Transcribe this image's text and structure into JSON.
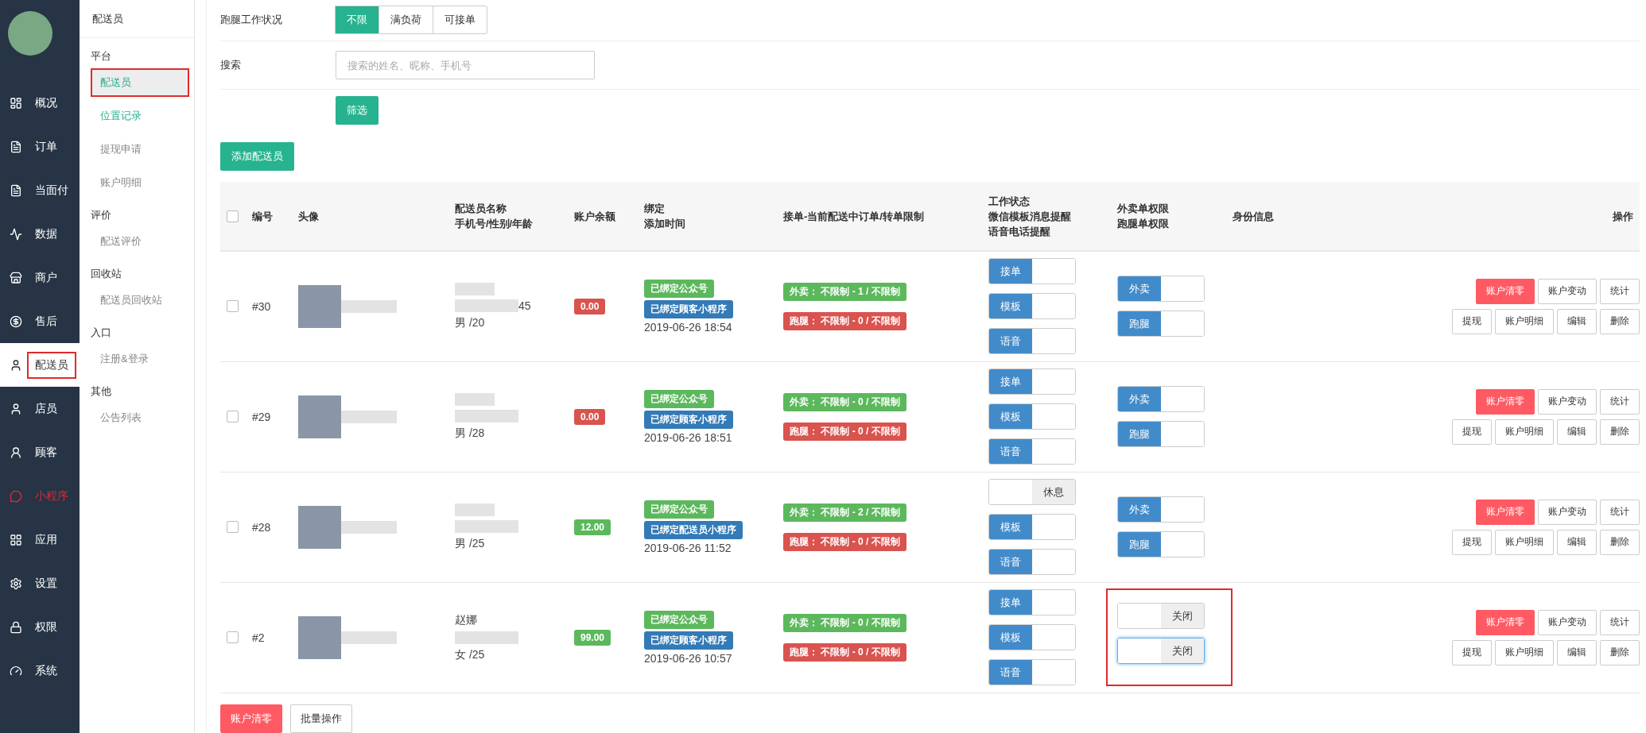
{
  "nav": {
    "items": [
      {
        "label": "概况",
        "selected": false,
        "highlighted": false,
        "alert": false
      },
      {
        "label": "订单",
        "selected": false,
        "highlighted": false,
        "alert": false
      },
      {
        "label": "当面付",
        "selected": false,
        "highlighted": false,
        "alert": false
      },
      {
        "label": "数据",
        "selected": false,
        "highlighted": false,
        "alert": false
      },
      {
        "label": "商户",
        "selected": false,
        "highlighted": false,
        "alert": false
      },
      {
        "label": "售后",
        "selected": false,
        "highlighted": false,
        "alert": false
      },
      {
        "label": "配送员",
        "selected": true,
        "highlighted": true,
        "alert": false
      },
      {
        "label": "店员",
        "selected": false,
        "highlighted": false,
        "alert": false
      },
      {
        "label": "顾客",
        "selected": false,
        "highlighted": false,
        "alert": false
      },
      {
        "label": "小程序",
        "selected": false,
        "highlighted": false,
        "alert": true
      },
      {
        "label": "应用",
        "selected": false,
        "highlighted": false,
        "alert": false
      },
      {
        "label": "设置",
        "selected": false,
        "highlighted": false,
        "alert": false
      },
      {
        "label": "权限",
        "selected": false,
        "highlighted": false,
        "alert": false
      },
      {
        "label": "系统",
        "selected": false,
        "highlighted": false,
        "alert": false
      }
    ]
  },
  "subnav": {
    "title": "配送员",
    "groups": [
      {
        "title": "平台",
        "items": [
          {
            "label": "配送员",
            "selected": true,
            "hovered": false,
            "highlighted": true
          },
          {
            "label": "位置记录",
            "selected": false,
            "hovered": true,
            "highlighted": false
          },
          {
            "label": "提现申请",
            "selected": false,
            "hovered": false,
            "highlighted": false
          },
          {
            "label": "账户明细",
            "selected": false,
            "hovered": false,
            "highlighted": false
          }
        ]
      },
      {
        "title": "评价",
        "items": [
          {
            "label": "配送评价",
            "selected": false,
            "hovered": false,
            "highlighted": false
          }
        ]
      },
      {
        "title": "回收站",
        "items": [
          {
            "label": "配送员回收站",
            "selected": false,
            "hovered": false,
            "highlighted": false
          }
        ]
      },
      {
        "title": "入口",
        "items": [
          {
            "label": "注册&登录",
            "selected": false,
            "hovered": false,
            "highlighted": false
          }
        ]
      },
      {
        "title": "其他",
        "items": [
          {
            "label": "公告列表",
            "selected": false,
            "hovered": false,
            "highlighted": false
          }
        ]
      }
    ]
  },
  "filter": {
    "status_label": "跑腿工作状况",
    "status_options": [
      {
        "label": "不限",
        "selected": true
      },
      {
        "label": "满负荷",
        "selected": false
      },
      {
        "label": "可接单",
        "selected": false
      }
    ],
    "search_label": "搜索",
    "search": {
      "placeholder": "搜索的姓名、昵称、手机号"
    },
    "filter_button": "筛选"
  },
  "add_button": "添加配送员",
  "table": {
    "columns": [
      [
        "编号"
      ],
      [
        "头像"
      ],
      [
        "配送员名称",
        "手机号/性别/年龄"
      ],
      [
        "账户余额"
      ],
      [
        "绑定",
        "添加时间"
      ],
      [
        "接单-当前配送中订单/转单限制"
      ],
      [
        "工作状态",
        "微信模板消息提醒",
        "语音电话提醒"
      ],
      [
        "外卖单权限",
        "跑腿单权限"
      ],
      [
        "身份信息"
      ],
      [
        "操作"
      ]
    ],
    "header_checked": false,
    "rows": [
      {
        "checked": false,
        "id": "#30",
        "phone_tail": "45",
        "gender_age": "男 /20",
        "balance": {
          "value": "0.00",
          "color": "#d9534f"
        },
        "bindings": [
          {
            "label": "已绑定公众号",
            "color": "#5cb85c"
          },
          {
            "label": "已绑定顾客小程序",
            "color": "#337ab7"
          }
        ],
        "added": "2019-06-26 18:54",
        "limits": [
          {
            "label": "外卖：",
            "value": "不限制 - 1 / 不限制",
            "color": "#5cb85c"
          },
          {
            "label": "跑腿：",
            "value": "不限制 - 0 / 不限制",
            "color": "#d9534f"
          }
        ],
        "work": [
          {
            "label": "接单",
            "on": true
          },
          {
            "label": "模板",
            "on": true
          },
          {
            "label": "语音",
            "on": true
          }
        ],
        "perms": [
          {
            "label": "外卖",
            "on": true,
            "focused": false
          },
          {
            "label": "跑腿",
            "on": true,
            "focused": false
          }
        ],
        "perms_highlighted": false,
        "actions": [
          [
            {
              "label": "账户清零",
              "kind": "danger"
            },
            {
              "label": "账户变动",
              "kind": "default"
            },
            {
              "label": "统计",
              "kind": "default"
            }
          ],
          [
            {
              "label": "提现",
              "kind": "default"
            },
            {
              "label": "账户明细",
              "kind": "default"
            },
            {
              "label": "编辑",
              "kind": "default"
            },
            {
              "label": "删除",
              "kind": "default"
            }
          ]
        ]
      },
      {
        "checked": false,
        "id": "#29",
        "gender_age": "男 /28",
        "balance": {
          "value": "0.00",
          "color": "#d9534f"
        },
        "bindings": [
          {
            "label": "已绑定公众号",
            "color": "#5cb85c"
          },
          {
            "label": "已绑定顾客小程序",
            "color": "#337ab7"
          }
        ],
        "added": "2019-06-26 18:51",
        "limits": [
          {
            "label": "外卖：",
            "value": "不限制 - 0 / 不限制",
            "color": "#5cb85c"
          },
          {
            "label": "跑腿：",
            "value": "不限制 - 0 / 不限制",
            "color": "#d9534f"
          }
        ],
        "work": [
          {
            "label": "接单",
            "on": true
          },
          {
            "label": "模板",
            "on": true
          },
          {
            "label": "语音",
            "on": true
          }
        ],
        "perms": [
          {
            "label": "外卖",
            "on": true,
            "focused": false
          },
          {
            "label": "跑腿",
            "on": true,
            "focused": false
          }
        ],
        "perms_highlighted": false,
        "actions": [
          [
            {
              "label": "账户清零",
              "kind": "danger"
            },
            {
              "label": "账户变动",
              "kind": "default"
            },
            {
              "label": "统计",
              "kind": "default"
            }
          ],
          [
            {
              "label": "提现",
              "kind": "default"
            },
            {
              "label": "账户明细",
              "kind": "default"
            },
            {
              "label": "编辑",
              "kind": "default"
            },
            {
              "label": "删除",
              "kind": "default"
            }
          ]
        ]
      },
      {
        "checked": false,
        "id": "#28",
        "gender_age": "男 /25",
        "balance": {
          "value": "12.00",
          "color": "#5cb85c"
        },
        "bindings": [
          {
            "label": "已绑定公众号",
            "color": "#5cb85c"
          },
          {
            "label": "已绑定配送员小程序",
            "color": "#337ab7"
          }
        ],
        "added": "2019-06-26 11:52",
        "limits": [
          {
            "label": "外卖：",
            "value": "不限制 - 2 / 不限制",
            "color": "#5cb85c"
          },
          {
            "label": "跑腿：",
            "value": "不限制 - 0 / 不限制",
            "color": "#d9534f"
          }
        ],
        "work": [
          {
            "label": "休息",
            "on": false
          },
          {
            "label": "模板",
            "on": true
          },
          {
            "label": "语音",
            "on": true
          }
        ],
        "perms": [
          {
            "label": "外卖",
            "on": true,
            "focused": false
          },
          {
            "label": "跑腿",
            "on": true,
            "focused": false
          }
        ],
        "perms_highlighted": false,
        "actions": [
          [
            {
              "label": "账户清零",
              "kind": "danger"
            },
            {
              "label": "账户变动",
              "kind": "default"
            },
            {
              "label": "统计",
              "kind": "default"
            }
          ],
          [
            {
              "label": "提现",
              "kind": "default"
            },
            {
              "label": "账户明细",
              "kind": "default"
            },
            {
              "label": "编辑",
              "kind": "default"
            },
            {
              "label": "删除",
              "kind": "default"
            }
          ]
        ]
      },
      {
        "checked": false,
        "id": "#2",
        "name": "赵娜",
        "gender_age": "女 /25",
        "balance": {
          "value": "99.00",
          "color": "#5cb85c"
        },
        "bindings": [
          {
            "label": "已绑定公众号",
            "color": "#5cb85c"
          },
          {
            "label": "已绑定顾客小程序",
            "color": "#337ab7"
          }
        ],
        "added": "2019-06-26 10:57",
        "limits": [
          {
            "label": "外卖：",
            "value": "不限制 - 0 / 不限制",
            "color": "#5cb85c"
          },
          {
            "label": "跑腿：",
            "value": "不限制 - 0 / 不限制",
            "color": "#d9534f"
          }
        ],
        "work": [
          {
            "label": "接单",
            "on": true
          },
          {
            "label": "模板",
            "on": true
          },
          {
            "label": "语音",
            "on": true
          }
        ],
        "perms": [
          {
            "label": "关闭",
            "on": false,
            "focused": false
          },
          {
            "label": "关闭",
            "on": false,
            "focused": true
          }
        ],
        "perms_highlighted": true,
        "actions": [
          [
            {
              "label": "账户清零",
              "kind": "danger"
            },
            {
              "label": "账户变动",
              "kind": "default"
            },
            {
              "label": "统计",
              "kind": "default"
            }
          ],
          [
            {
              "label": "提现",
              "kind": "default"
            },
            {
              "label": "账户明细",
              "kind": "default"
            },
            {
              "label": "编辑",
              "kind": "default"
            },
            {
              "label": "删除",
              "kind": "default"
            }
          ]
        ]
      }
    ]
  },
  "bulk_actions": [
    {
      "label": "账户清零",
      "kind": "danger"
    },
    {
      "label": "批量操作",
      "kind": "default"
    }
  ]
}
